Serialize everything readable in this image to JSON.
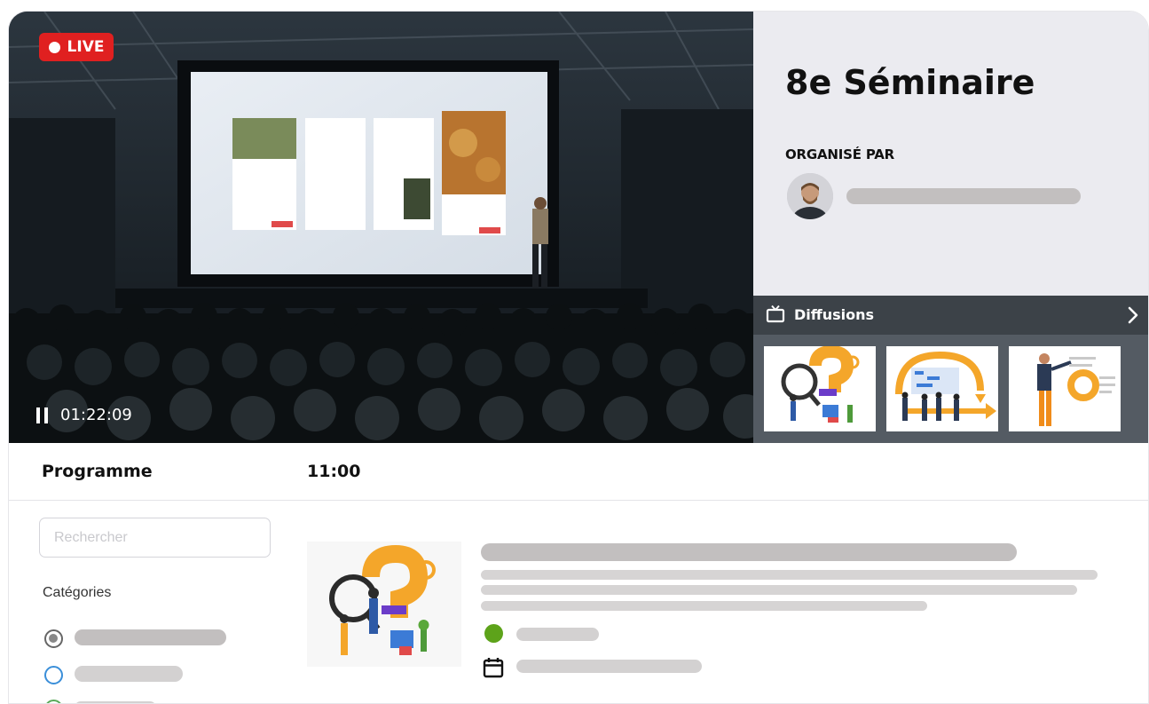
{
  "live_badge": {
    "label": "LIVE",
    "color": "#e02020"
  },
  "player": {
    "elapsed": "01:22:09",
    "state_icon": "pause-icon"
  },
  "event": {
    "title": "8e Séminaire",
    "organiser_label": "ORGANISÉ PAR"
  },
  "diffusions": {
    "title": "Diffusions",
    "icon": "tv-icon",
    "more_icon": "chevron-right-icon",
    "thumbnails": [
      "question-illustration",
      "workflow-illustration",
      "presenter-illustration"
    ]
  },
  "programme": {
    "title": "Programme",
    "time": "11:00"
  },
  "filters": {
    "search_placeholder": "Rechercher",
    "categories_label": "Catégories",
    "category_colors": [
      "#666666",
      "#3b8fd9",
      "#5aaa5a"
    ]
  },
  "session_card": {
    "status_color": "#5da31a",
    "calendar_icon": "calendar-icon"
  },
  "colors": {
    "accent_live": "#e02020",
    "info_panel": "#ebebf0",
    "diffusion_bar": "#3c4248",
    "skeleton": "#c2bfbf"
  }
}
